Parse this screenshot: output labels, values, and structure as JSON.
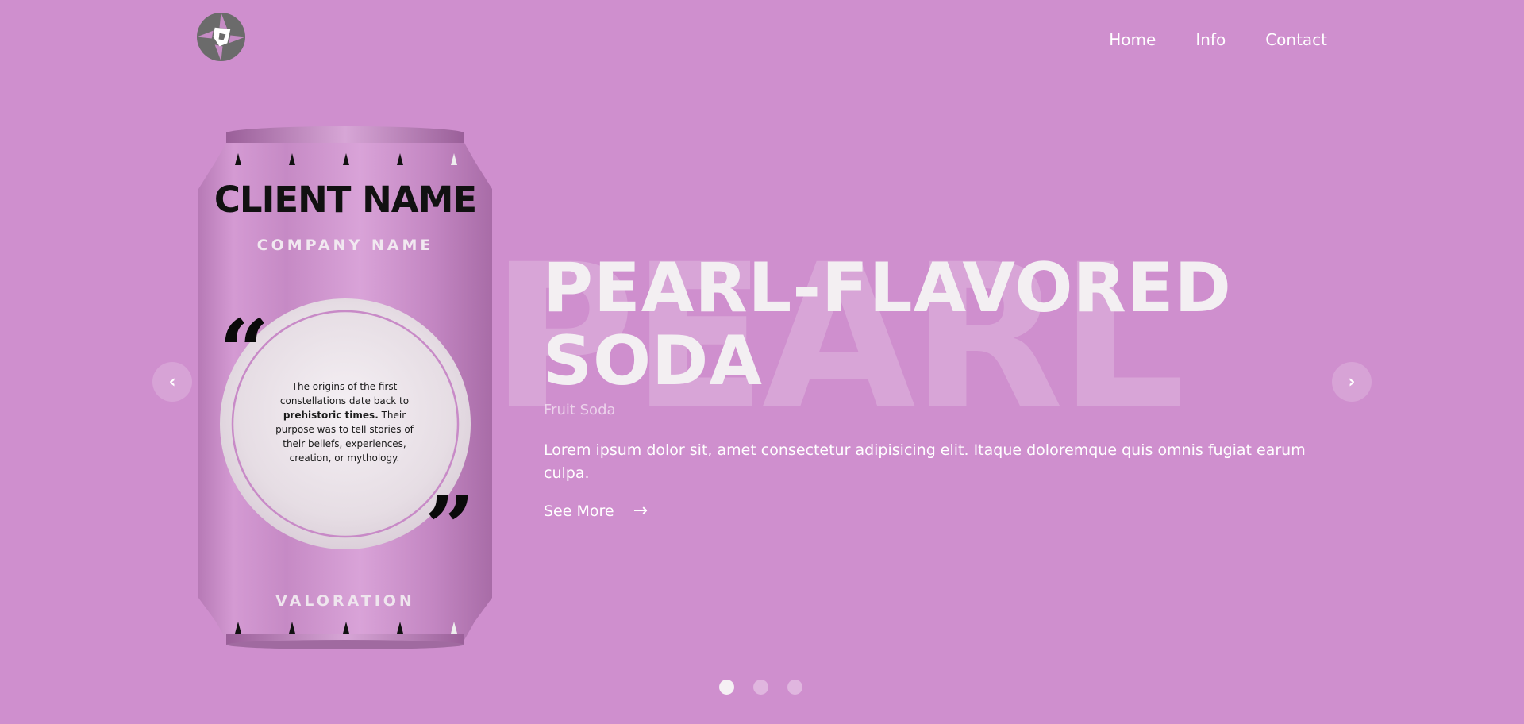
{
  "header": {
    "logo_icon": "aperture-logo-icon",
    "nav": [
      {
        "label": "Home"
      },
      {
        "label": "Info"
      },
      {
        "label": "Contact"
      }
    ]
  },
  "hero": {
    "background_word": "PEARL",
    "title_line1": "PEARL-FLAVORED",
    "title_line2": "SODA",
    "subtitle": "Fruit Soda",
    "description": "Lorem ipsum dolor sit, amet consectetur adipisicing elit. Itaque doloremque quis omnis fugiat earum culpa.",
    "cta_label": "See More",
    "cta_icon": "arrow-right-icon"
  },
  "can": {
    "client_name": "CLIENT NAME",
    "company_name": "COMPANY NAME",
    "quote_before": "The origins of the first constellations date back to",
    "quote_bold": "prehistoric times.",
    "quote_after": "Their purpose was to tell stories of their beliefs, experiences, creation, or mythology.",
    "valoration": "VALORATION",
    "open_quote_icon": "open-quote-icon",
    "close_quote_icon": "close-quote-icon"
  },
  "carousel": {
    "prev_icon": "chevron-left-icon",
    "next_icon": "chevron-right-icon",
    "slide_count": 3,
    "active_index": 0
  },
  "colors": {
    "background": "#cf8fce",
    "can_body": "#c98cc8",
    "text_light": "#f3eff2"
  }
}
